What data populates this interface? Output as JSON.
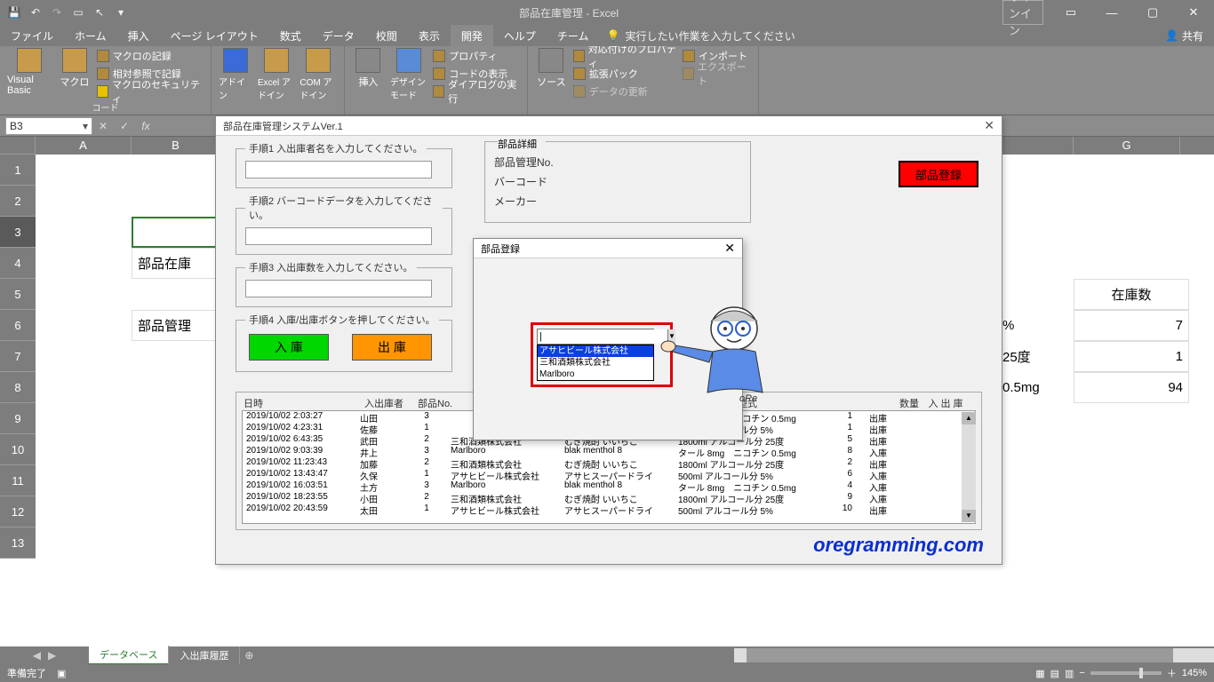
{
  "titlebar": {
    "title": "部品在庫管理 - Excel",
    "signin": "サインイン"
  },
  "tabs": [
    "ファイル",
    "ホーム",
    "挿入",
    "ページ レイアウト",
    "数式",
    "データ",
    "校閲",
    "表示",
    "開発",
    "ヘルプ",
    "チーム"
  ],
  "active_tab": 8,
  "tell_me": "実行したい作業を入力してください",
  "share": "共有",
  "ribbon": {
    "code_group": "コード",
    "vb": "Visual Basic",
    "macro": "マクロ",
    "rec": "マクロの記録",
    "relref": "相対参照で記録",
    "sec": "マクロのセキュリティ",
    "addin": "アドイン",
    "exceladdin": "Excel アドイン",
    "com": "COM アドイン",
    "insert": "挿入",
    "design": "デザイン モード",
    "props": "プロパティ",
    "viewcode": "コードの表示",
    "dialog": "ダイアログの実行",
    "source": "ソース",
    "mapprops": "対応付けのプロパティ",
    "exppack": "拡張パック",
    "refresh": "データの更新",
    "import": "インポート",
    "export": "エクスポート"
  },
  "namebox": "B3",
  "colheaders": {
    "A": "A",
    "B": "B",
    "G": "G"
  },
  "rowcount": 13,
  "sheet_cells": {
    "b5": "部品在庫",
    "b7": "部品管理",
    "g5": "在庫数",
    "g6": "7",
    "g7": "1",
    "g8": "94",
    "f6": "%",
    "f7": "25度",
    "f8": "0.5mg"
  },
  "sheet_tabs": {
    "active": "データベース",
    "other": "入出庫履歴"
  },
  "status": {
    "ready": "準備完了",
    "zoom": "145%"
  },
  "uf": {
    "title": "部品在庫管理システムVer.1",
    "s1": "手順1  入出庫者名を入力してください。",
    "s2": "手順2  バーコードデータを入力してください。",
    "s3": "手順3  入出庫数を入力してください。",
    "s4": "手順4  入庫/出庫ボタンを押してください。",
    "in": "入 庫",
    "out": "出 庫",
    "reg": "部品登録",
    "detail": {
      "head": "部品詳細",
      "no": "部品管理No.",
      "bc": "バーコード",
      "mk": "メーカー"
    },
    "hist_hdr": {
      "dt": "日時",
      "who": "入出庫者",
      "pno": "部品No.",
      "model": "型式",
      "qty": "数量",
      "io": "入 出 庫"
    },
    "hist": [
      {
        "dt": "2019/10/02 2:03:27",
        "who": "山田",
        "pno": "3",
        "mk": "",
        "pn": "",
        "model": "タール 8mg　ニコチン 0.5mg",
        "qty": "1",
        "io": "出庫"
      },
      {
        "dt": "2019/10/02 4:23:31",
        "who": "佐藤",
        "pno": "1",
        "mk": "",
        "pn": "",
        "model": "500ml アルコール分 5%",
        "qty": "1",
        "io": "出庫"
      },
      {
        "dt": "2019/10/02 6:43:35",
        "who": "武田",
        "pno": "2",
        "mk": "三和酒類株式会社",
        "pn": "むぎ焼酎 いいちこ",
        "model": "1800ml アルコール分 25度",
        "qty": "5",
        "io": "出庫"
      },
      {
        "dt": "2019/10/02 9:03:39",
        "who": "井上",
        "pno": "3",
        "mk": "Marlboro",
        "pn": "blak menthol 8",
        "model": "タール 8mg　ニコチン 0.5mg",
        "qty": "8",
        "io": "入庫"
      },
      {
        "dt": "2019/10/02 11:23:43",
        "who": "加藤",
        "pno": "2",
        "mk": "三和酒類株式会社",
        "pn": "むぎ焼酎 いいちこ",
        "model": "1800ml アルコール分 25度",
        "qty": "2",
        "io": "出庫"
      },
      {
        "dt": "2019/10/02 13:43:47",
        "who": "久保",
        "pno": "1",
        "mk": "アサヒビール株式会社",
        "pn": "アサヒスーパードライ",
        "model": "500ml アルコール分 5%",
        "qty": "6",
        "io": "入庫"
      },
      {
        "dt": "2019/10/02 16:03:51",
        "who": "土方",
        "pno": "3",
        "mk": "Marlboro",
        "pn": "blak menthol 8",
        "model": "タール 8mg　ニコチン 0.5mg",
        "qty": "4",
        "io": "入庫"
      },
      {
        "dt": "2019/10/02 18:23:55",
        "who": "小田",
        "pno": "2",
        "mk": "三和酒類株式会社",
        "pn": "むぎ焼酎 いいちこ",
        "model": "1800ml アルコール分 25度",
        "qty": "9",
        "io": "入庫"
      },
      {
        "dt": "2019/10/02 20:43:59",
        "who": "太田",
        "pno": "1",
        "mk": "アサヒビール株式会社",
        "pn": "アサヒスーパードライ",
        "model": "500ml アルコール分 5%",
        "qty": "10",
        "io": "出庫"
      }
    ]
  },
  "uf2": {
    "title": "部品登録",
    "options": [
      "アサヒビール株式会社",
      "三和酒類株式会社",
      "Marlboro"
    ],
    "selected": 0
  },
  "watermark": "oregramming.com"
}
